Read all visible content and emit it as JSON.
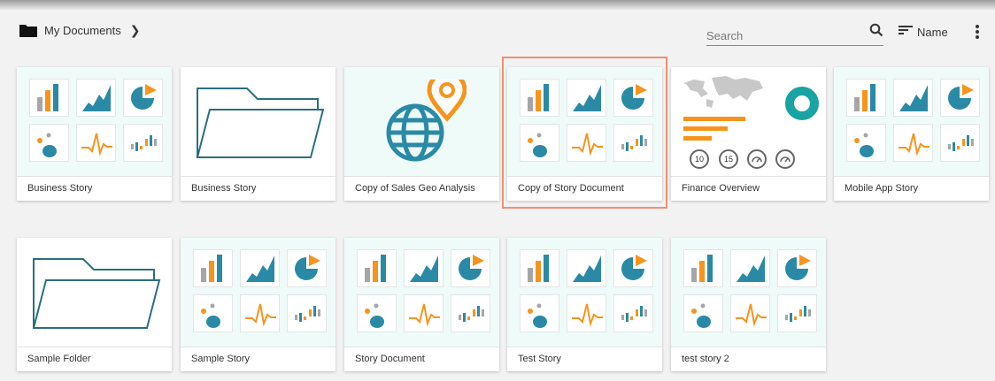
{
  "breadcrumb": {
    "label": "My Documents"
  },
  "search": {
    "placeholder": "Search",
    "value": ""
  },
  "sort": {
    "label": "Name"
  },
  "colors": {
    "teal": "#2a8aa6",
    "orange": "#f7941d",
    "grey": "#a6a6a6",
    "highlight": "#f09070",
    "thumb_bg": "#eefbf9"
  },
  "cards": [
    {
      "title": "Business Story",
      "thumb": "story-grid"
    },
    {
      "title": "Business Story",
      "thumb": "folder"
    },
    {
      "title": "Copy of Sales Geo Analysis",
      "thumb": "globe-pin"
    },
    {
      "title": "Copy of Story Document",
      "thumb": "story-grid",
      "selected": true
    },
    {
      "title": "Finance Overview",
      "thumb": "finance-dashboard",
      "gauges": [
        "10",
        "15"
      ]
    },
    {
      "title": "Mobile App Story",
      "thumb": "story-grid"
    },
    {
      "title": "Sample Folder",
      "thumb": "folder"
    },
    {
      "title": "Sample Story",
      "thumb": "story-grid"
    },
    {
      "title": "Story Document",
      "thumb": "story-grid"
    },
    {
      "title": "Test Story",
      "thumb": "story-grid"
    },
    {
      "title": "test story 2",
      "thumb": "story-grid"
    }
  ]
}
